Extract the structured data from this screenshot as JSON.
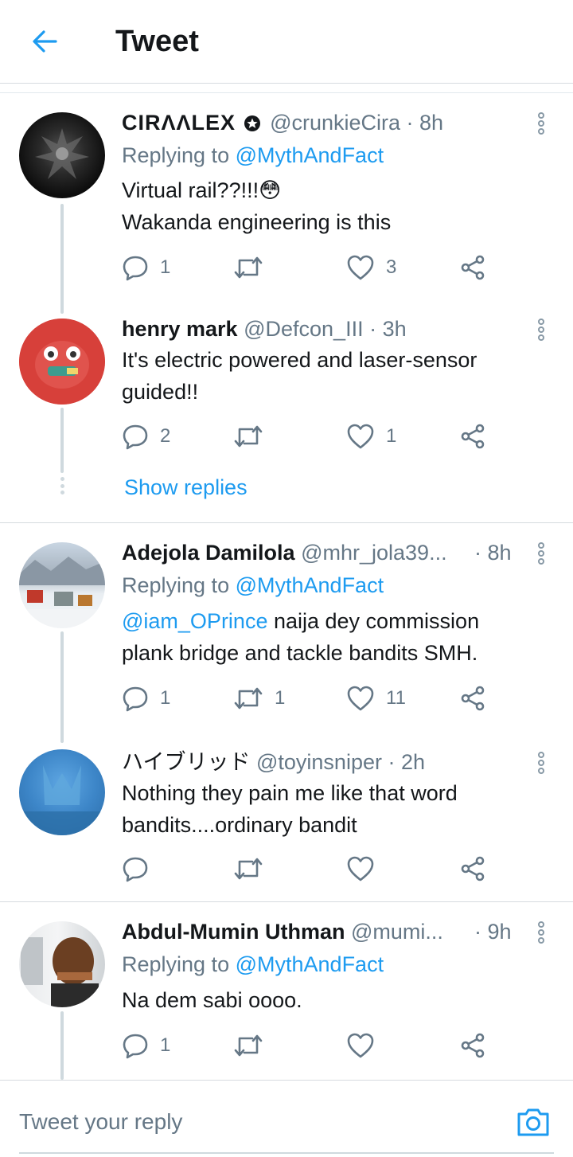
{
  "header": {
    "title": "Tweet",
    "back_icon": "arrow-left-icon",
    "accent": "#1d9bf0"
  },
  "tweets": [
    {
      "name": "CIRΛΛLEX",
      "badge_icon": "star-badge-icon",
      "handle": "@crunkieCira",
      "time": "· 8h",
      "replying_prefix": "Replying to",
      "replying_to": "@MythAndFact",
      "text_line1": "Virtual rail??!!!😳",
      "text_line2": "Wakanda engineering is this",
      "replies": "1",
      "retweets": "",
      "likes": "3"
    },
    {
      "name": "henry mark",
      "handle": "@Defcon_III",
      "time": "· 3h",
      "text_line1": "It's electric powered and laser-sensor",
      "text_line2": "guided!!",
      "replies": "2",
      "retweets": "",
      "likes": "1"
    },
    {
      "name": "Adejola Damilola",
      "handle": "@mhr_jola39...",
      "time": "· 8h",
      "replying_prefix": "Replying to",
      "replying_to": "@MythAndFact",
      "text_mention": "@iam_OPrince",
      "text_line1": " naija dey commission",
      "text_line2": "plank bridge and tackle bandits SMH.",
      "replies": "1",
      "retweets": "1",
      "likes": "11"
    },
    {
      "name": "ハイブリッド",
      "handle": "@toyinsniper",
      "time": "· 2h",
      "text_line1": "Nothing they pain me like that word",
      "text_line2": "bandits....ordinary bandit",
      "replies": "",
      "retweets": "",
      "likes": ""
    },
    {
      "name": "Abdul-Mumin Uthman",
      "handle": "@mumi...",
      "time": "· 9h",
      "replying_prefix": "Replying to",
      "replying_to": "@MythAndFact",
      "text_line1": "Na dem sabi oooo.",
      "replies": "1",
      "retweets": "",
      "likes": ""
    }
  ],
  "show_replies": "Show replies",
  "composer": {
    "placeholder": "Tweet your reply",
    "camera_icon": "camera-icon"
  }
}
